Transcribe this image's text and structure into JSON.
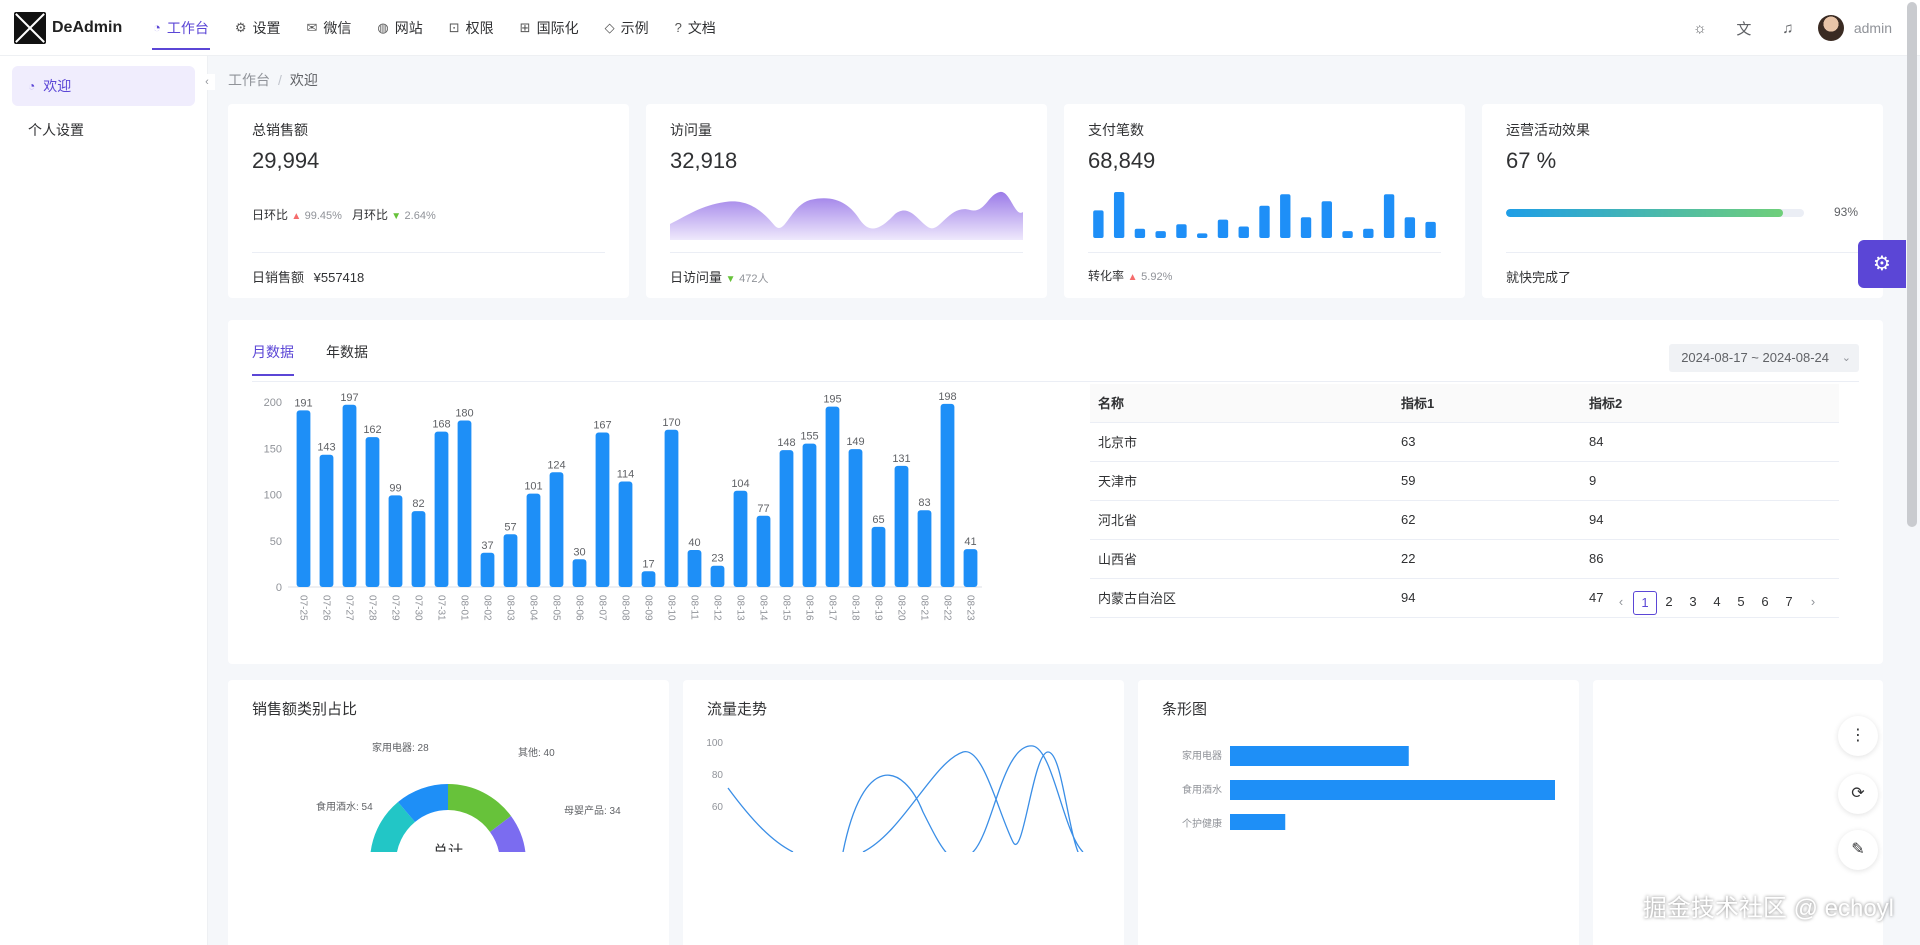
{
  "app": {
    "logo_text": "DeAdmin"
  },
  "nav": [
    {
      "label": "工作台",
      "icon": "dashboard-icon",
      "glyph": "◔"
    },
    {
      "label": "设置",
      "icon": "settings-icon",
      "glyph": "⚙"
    },
    {
      "label": "微信",
      "icon": "wechat-icon",
      "glyph": "✉"
    },
    {
      "label": "网站",
      "icon": "globe-icon",
      "glyph": "◍"
    },
    {
      "label": "权限",
      "icon": "lock-icon",
      "glyph": "⊡"
    },
    {
      "label": "国际化",
      "icon": "translate-icon",
      "glyph": "⊞"
    },
    {
      "label": "示例",
      "icon": "tag-icon",
      "glyph": "◇"
    },
    {
      "label": "文档",
      "icon": "help-icon",
      "glyph": "?"
    }
  ],
  "top_right": {
    "username": "admin"
  },
  "sidebar": {
    "items": [
      {
        "label": "欢迎"
      },
      {
        "label": "个人设置"
      }
    ]
  },
  "breadcrumb": {
    "root": "工作台",
    "current": "欢迎"
  },
  "stats": {
    "sales": {
      "title": "总销售额",
      "value": "29,994",
      "day_label": "日环比",
      "day_value": "99.45%",
      "month_label": "月环比",
      "month_value": "2.64%",
      "foot_label": "日销售额",
      "foot_value": "¥557418"
    },
    "visits": {
      "title": "访问量",
      "value": "32,918",
      "foot_label": "日访问量",
      "foot_value": "472人"
    },
    "payments": {
      "title": "支付笔数",
      "value": "68,849",
      "foot_label": "转化率",
      "foot_value": "5.92%",
      "bars": [
        12,
        20,
        4,
        3,
        6,
        2,
        8,
        5,
        14,
        19,
        9,
        16,
        3,
        4,
        19,
        9,
        7
      ]
    },
    "campaign": {
      "title": "运营活动效果",
      "value": "67 %",
      "progress": 93,
      "progress_label": "93%",
      "foot_label": "就快完成了"
    }
  },
  "tabs": {
    "month": "月数据",
    "year": "年数据",
    "date_range": "2024-08-17 ~ 2024-08-24"
  },
  "chart_data": {
    "type": "bar",
    "categories": [
      "07-25",
      "07-26",
      "07-27",
      "07-28",
      "07-29",
      "07-30",
      "07-31",
      "08-01",
      "08-02",
      "08-03",
      "08-04",
      "08-05",
      "08-06",
      "08-07",
      "08-08",
      "08-09",
      "08-10",
      "08-11",
      "08-12",
      "08-13",
      "08-14",
      "08-15",
      "08-16",
      "08-17",
      "08-18",
      "08-19",
      "08-20",
      "08-21",
      "08-22",
      "08-23"
    ],
    "values": [
      191,
      143,
      197,
      162,
      99,
      82,
      168,
      180,
      37,
      57,
      101,
      124,
      30,
      167,
      114,
      17,
      170,
      40,
      23,
      104,
      77,
      148,
      155,
      195,
      149,
      65,
      131,
      83,
      198,
      41
    ],
    "yticks": [
      0,
      50,
      100,
      150,
      200
    ],
    "ylim": [
      0,
      200
    ],
    "color": "#1e8ff7"
  },
  "table": {
    "headers": [
      "名称",
      "指标1",
      "指标2"
    ],
    "rows": [
      [
        "北京市",
        "63",
        "84"
      ],
      [
        "天津市",
        "59",
        "9"
      ],
      [
        "河北省",
        "62",
        "94"
      ],
      [
        "山西省",
        "22",
        "86"
      ],
      [
        "内蒙古自治区",
        "94",
        "47"
      ]
    ],
    "pages": [
      "1",
      "2",
      "3",
      "4",
      "5",
      "6",
      "7"
    ]
  },
  "panels": {
    "pie": {
      "title": "销售额类别占比",
      "center_label": "总计",
      "labels": [
        "家用电器: 28",
        "其他: 40",
        "食用酒水: 54",
        "母婴产品: 34"
      ]
    },
    "line": {
      "title": "流量走势",
      "yticks": [
        "100",
        "80",
        "60"
      ]
    },
    "hbar": {
      "title": "条形图",
      "categories": [
        "家用电器",
        "食用酒水",
        "个护健康"
      ],
      "values": [
        55,
        100,
        17
      ]
    }
  },
  "watermark": {
    "text": "DeAdmin",
    "credit": "掘金技术社区 @ echoyl"
  }
}
